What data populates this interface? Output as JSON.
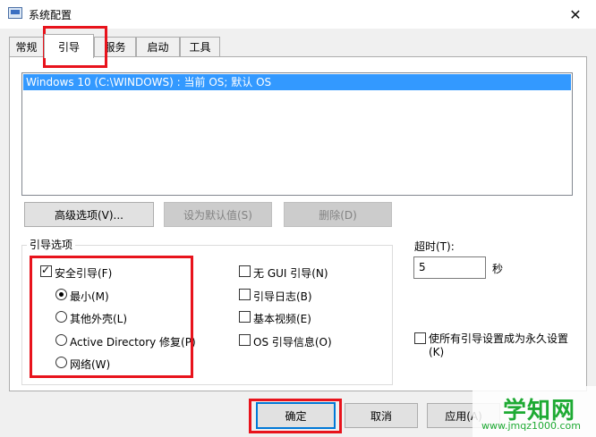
{
  "window": {
    "title": "系统配置",
    "close_glyph": "✕"
  },
  "tabs": [
    {
      "label": "常规",
      "active": false
    },
    {
      "label": "引导",
      "active": true
    },
    {
      "label": "服务",
      "active": false
    },
    {
      "label": "启动",
      "active": false
    },
    {
      "label": "工具",
      "active": false
    }
  ],
  "os_list": {
    "selected_item": "Windows 10 (C:\\WINDOWS) : 当前 OS; 默认 OS"
  },
  "buttons": {
    "advanced": "高级选项(V)...",
    "set_default": "设为默认值(S)",
    "delete": "删除(D)",
    "ok": "确定",
    "cancel": "取消",
    "apply": "应用(A)"
  },
  "boot_options": {
    "group_label": "引导选项",
    "safe_boot": {
      "label": "安全引导(F)",
      "checked": true
    },
    "radios": [
      {
        "label": "最小(M)",
        "checked": true
      },
      {
        "label": "其他外壳(L)",
        "checked": false
      },
      {
        "label": "Active Directory 修复(P)",
        "checked": false
      },
      {
        "label": "网络(W)",
        "checked": false
      }
    ],
    "checks": [
      {
        "label": "无 GUI 引导(N)",
        "checked": false
      },
      {
        "label": "引导日志(B)",
        "checked": false
      },
      {
        "label": "基本视频(E)",
        "checked": false
      },
      {
        "label": "OS 引导信息(O)",
        "checked": false
      }
    ]
  },
  "timeout": {
    "label": "超时(T):",
    "value": "5",
    "unit": "秒"
  },
  "permanent": {
    "label_line1": "使所有引导设置成为永久设置",
    "label_line2": "(K)",
    "checked": false
  },
  "watermark": {
    "text": "学知网",
    "url": "www.jmqz1000.com"
  },
  "colors": {
    "highlight": "#e8131c",
    "selection": "#3399ff"
  }
}
